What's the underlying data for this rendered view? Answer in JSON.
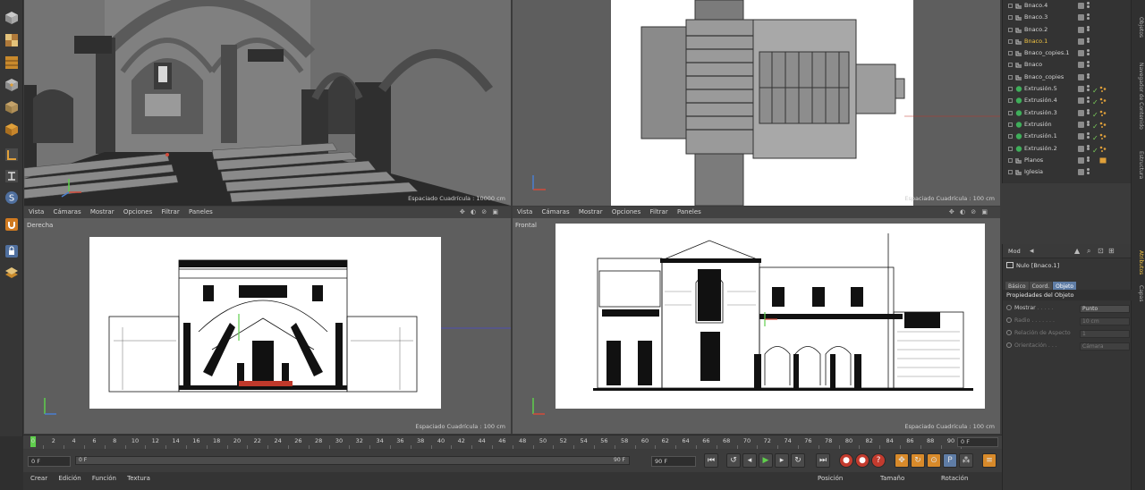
{
  "viewports": {
    "perspective": {
      "grid_spacing": "Espaciado Cuadrícula : 10000 cm"
    },
    "top": {
      "grid_spacing": "Espaciado Cuadrícula : 100 cm"
    },
    "right": {
      "label": "Derecha",
      "grid_spacing": "Espaciado Cuadrícula : 100 cm",
      "menu": [
        "Vista",
        "Cámaras",
        "Mostrar",
        "Opciones",
        "Filtrar",
        "Paneles"
      ]
    },
    "front": {
      "label": "Frontal",
      "grid_spacing": "Espaciado Cuadrícula : 100 cm",
      "menu": [
        "Vista",
        "Cámaras",
        "Mostrar",
        "Opciones",
        "Filtrar",
        "Paneles"
      ]
    },
    "nav_controls": "✥ ◐ ⊘ ▣"
  },
  "object_manager": {
    "objects": [
      {
        "name": "Bnaco.4",
        "active": false,
        "type": "null"
      },
      {
        "name": "Bnaco.3",
        "active": false,
        "type": "null"
      },
      {
        "name": "Bnaco.2",
        "active": false,
        "type": "null"
      },
      {
        "name": "Bnaco.1",
        "active": true,
        "type": "null"
      },
      {
        "name": "Bnaco_copies.1",
        "active": false,
        "type": "null"
      },
      {
        "name": "Bnaco",
        "active": false,
        "type": "null"
      },
      {
        "name": "Bnaco_copies",
        "active": false,
        "type": "null"
      },
      {
        "name": "Extrusión.5",
        "active": false,
        "type": "extrude"
      },
      {
        "name": "Extrusión.4",
        "active": false,
        "type": "extrude"
      },
      {
        "name": "Extrusión.3",
        "active": false,
        "type": "extrude"
      },
      {
        "name": "Extrusión",
        "active": false,
        "type": "extrude"
      },
      {
        "name": "Extrusión.1",
        "active": false,
        "type": "extrude"
      },
      {
        "name": "Extrusión.2",
        "active": false,
        "type": "extrude"
      },
      {
        "name": "Planos",
        "active": false,
        "type": "null"
      },
      {
        "name": "Iglesia",
        "active": false,
        "type": "null"
      }
    ]
  },
  "side_tabs": [
    "Objetos",
    "Navegador de Contenido",
    "Estructura",
    "Atributos",
    "Capas"
  ],
  "attributes": {
    "mode_label": "Mod",
    "object_title": "Nulo [Bnaco.1]",
    "tabs": [
      "Básico",
      "Coord.",
      "Objeto"
    ],
    "selected_tab": "Objeto",
    "section": "Propiedades del Objeto",
    "props": [
      {
        "label": "Mostrar",
        "value": "Punto",
        "dim": false
      },
      {
        "label": "Radio",
        "value": "10 cm",
        "dim": true
      },
      {
        "label": "Relación de Aspecto",
        "value": "1",
        "dim": true
      },
      {
        "label": "Orientación",
        "value": "Cámara",
        "dim": true
      }
    ]
  },
  "timeline": {
    "ticks": [
      "0",
      "2",
      "4",
      "6",
      "8",
      "10",
      "12",
      "14",
      "16",
      "18",
      "20",
      "22",
      "24",
      "26",
      "28",
      "30",
      "32",
      "34",
      "36",
      "38",
      "40",
      "42",
      "44",
      "46",
      "48",
      "50",
      "52",
      "54",
      "56",
      "58",
      "60",
      "62",
      "64",
      "66",
      "68",
      "70",
      "72",
      "74",
      "76",
      "78",
      "80",
      "82",
      "84",
      "86",
      "88",
      "90"
    ],
    "current_frame": "0 F"
  },
  "transport": {
    "start": "0 F",
    "range_start": "0 F",
    "range_end": "90 F",
    "end": "90 F"
  },
  "material_menu": [
    "Crear",
    "Edición",
    "Función",
    "Textura"
  ],
  "coord_headers": [
    "Posición",
    "Tamaño",
    "Rotación"
  ],
  "colors": {
    "accent_yellow": "#f2c443",
    "selected_tab": "#5f7da6",
    "timeline_playhead": "#5fcf4c",
    "record_red": "#c33b2e"
  }
}
